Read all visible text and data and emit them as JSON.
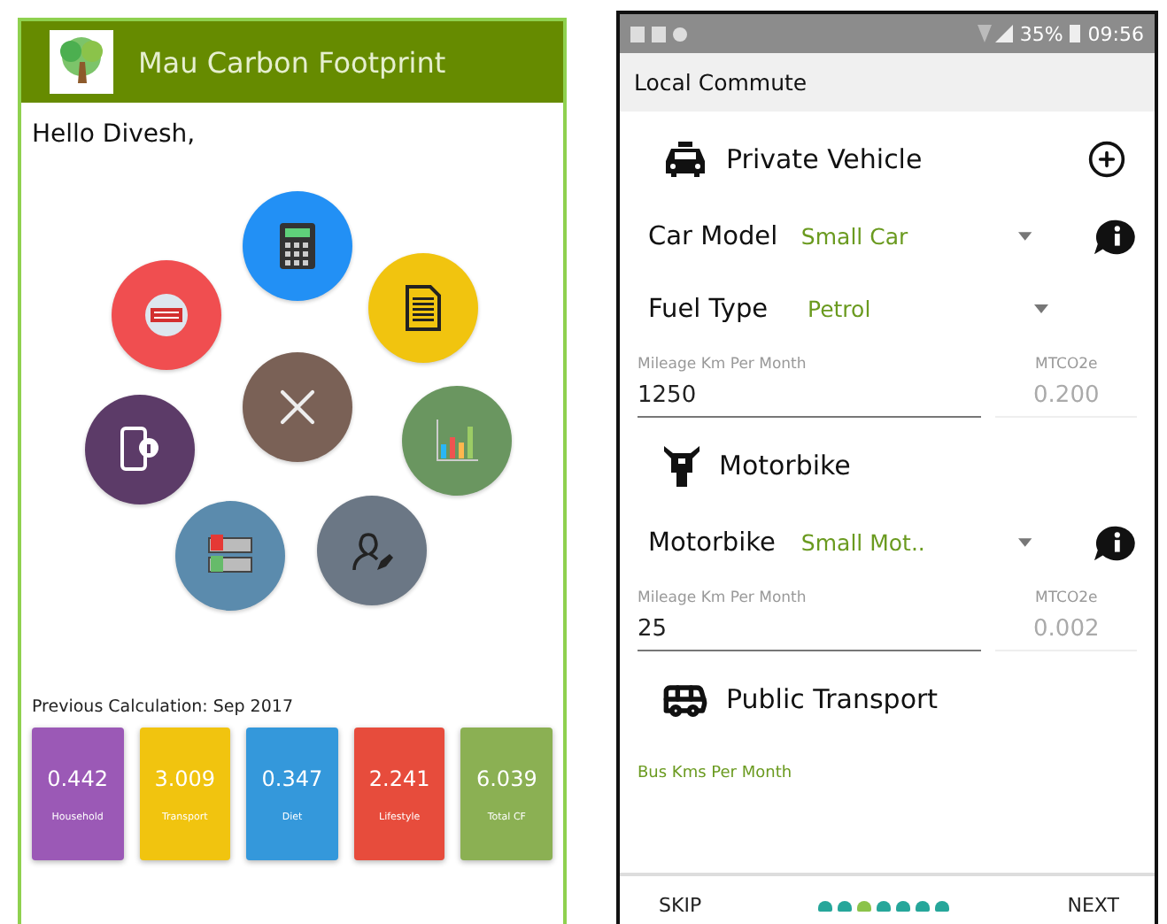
{
  "left_screen": {
    "app_bar": {
      "title": "Mau Carbon Footprint"
    },
    "greeting": "Hello Divesh,",
    "menu": {
      "items": [
        {
          "kind": "calculator",
          "color": "#2290f5"
        },
        {
          "kind": "document",
          "color": "#f1c40f"
        },
        {
          "kind": "chart",
          "color": "#6a9660"
        },
        {
          "kind": "profile",
          "color": "#6b7785"
        },
        {
          "kind": "cards",
          "color": "#5b8bad"
        },
        {
          "kind": "phone",
          "color": "#5c3b68"
        },
        {
          "kind": "exit",
          "color": "#f04e50"
        }
      ],
      "center": {
        "kind": "close",
        "color": "#7a6156"
      }
    },
    "previous": {
      "title": "Previous Calculation: Sep 2017",
      "cards": [
        {
          "value": "0.442",
          "label": "Household",
          "color": "#9b59b6"
        },
        {
          "value": "3.009",
          "label": "Transport",
          "color": "#f1c40f"
        },
        {
          "value": "0.347",
          "label": "Diet",
          "color": "#3498db"
        },
        {
          "value": "2.241",
          "label": "Lifestyle",
          "color": "#e74c3c"
        },
        {
          "value": "6.039",
          "label": "Total CF",
          "color": "#8bb053"
        }
      ]
    }
  },
  "right_screen": {
    "status_bar": {
      "battery": "35%",
      "time": "09:56"
    },
    "title": "Local Commute",
    "sections": [
      {
        "kind": "car",
        "title": "Private Vehicle",
        "add_button": true,
        "dropdowns": [
          {
            "label": "Car Model",
            "value": "Small Car",
            "info": true
          },
          {
            "label": "Fuel Type",
            "value": "Petrol",
            "info": false
          }
        ],
        "mileage": {
          "label": "Mileage Km Per Month",
          "value": "1250",
          "result_label": "MTCO2e",
          "result": "0.200"
        }
      },
      {
        "kind": "motorbike",
        "title": "Motorbike",
        "add_button": false,
        "dropdowns": [
          {
            "label": "Motorbike",
            "value": "Small Mot..",
            "info": true
          }
        ],
        "mileage": {
          "label": "Mileage Km Per Month",
          "value": "25",
          "result_label": "MTCO2e",
          "result": "0.002"
        }
      },
      {
        "kind": "bus",
        "title": "Public Transport",
        "add_button": false,
        "hint": "Bus Kms Per Month"
      }
    ],
    "footer": {
      "skip": "SKIP",
      "next": "NEXT",
      "dots": [
        {
          "selected": false
        },
        {
          "selected": false
        },
        {
          "selected": true
        },
        {
          "selected": false
        },
        {
          "selected": false
        },
        {
          "selected": false
        },
        {
          "selected": false
        }
      ]
    }
  }
}
